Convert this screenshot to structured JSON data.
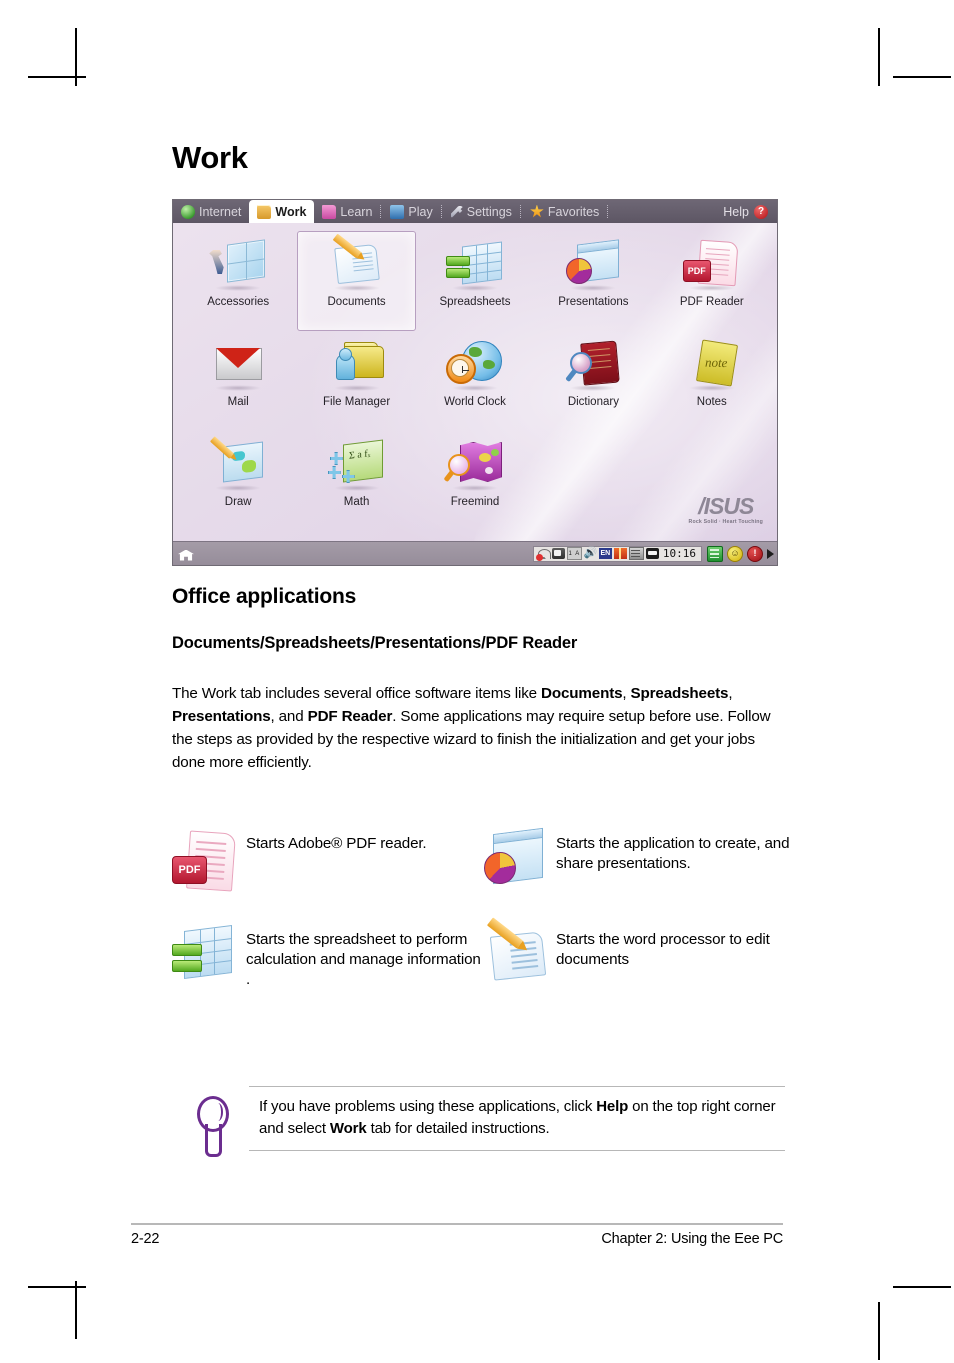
{
  "page": {
    "title": "Work",
    "footer_left": "2-22",
    "footer_right": "Chapter 2: Using the Eee PC"
  },
  "screenshot": {
    "tabs": [
      {
        "label": "Internet",
        "icon": "globe-icon",
        "active": false
      },
      {
        "label": "Work",
        "icon": "folder-work-icon",
        "active": true
      },
      {
        "label": "Learn",
        "icon": "folder-learn-icon",
        "active": false
      },
      {
        "label": "Play",
        "icon": "play-icon",
        "active": false
      },
      {
        "label": "Settings",
        "icon": "wrench-icon",
        "active": false
      },
      {
        "label": "Favorites",
        "icon": "star-icon",
        "active": false
      }
    ],
    "help_label": "Help",
    "help_icon": "question-mark-icon",
    "apps": [
      {
        "label": "Accessories",
        "icon": "accessories-icon",
        "selected": false
      },
      {
        "label": "Documents",
        "icon": "documents-icon",
        "selected": true
      },
      {
        "label": "Spreadsheets",
        "icon": "spreadsheets-icon",
        "selected": false
      },
      {
        "label": "Presentations",
        "icon": "presentations-icon",
        "selected": false
      },
      {
        "label": "PDF Reader",
        "icon": "pdf-reader-icon",
        "selected": false
      },
      {
        "label": "Mail",
        "icon": "mail-icon",
        "selected": false
      },
      {
        "label": "File Manager",
        "icon": "file-manager-icon",
        "selected": false
      },
      {
        "label": "World Clock",
        "icon": "world-clock-icon",
        "selected": false
      },
      {
        "label": "Dictionary",
        "icon": "dictionary-icon",
        "selected": false
      },
      {
        "label": "Notes",
        "icon": "notes-icon",
        "selected": false
      },
      {
        "label": "Draw",
        "icon": "draw-icon",
        "selected": false
      },
      {
        "label": "Math",
        "icon": "math-icon",
        "selected": false
      },
      {
        "label": "Freemind",
        "icon": "freemind-icon",
        "selected": false
      }
    ],
    "pdf_badge_text": "PDF",
    "notes_glyph": "note",
    "math_glyph": "Σ a  fₓ",
    "brand": {
      "word": "/ISUS",
      "tagline": "Rock Solid · Heart Touching"
    },
    "taskbar": {
      "home_icon": "home-icon",
      "tray_icons": [
        "wireless-disabled-icon",
        "battery-icon",
        "keyboard-layout-icon",
        "volume-icon",
        "input-method-en-icon",
        "gift-icon",
        "storage-icon",
        "network-icon"
      ],
      "keyboard_label": "1 A",
      "input_method_label": "EN",
      "clock": "10:16",
      "right_icons": [
        "calculator-icon",
        "smiley-icon",
        "power-icon",
        "expand-arrow-icon"
      ],
      "power_glyph": "!",
      "smiley_glyph": "☺"
    }
  },
  "content": {
    "h2": "Office applications",
    "h3": "Documents/Spreadsheets/Presentations/PDF Reader",
    "paragraph": {
      "p1": "The Work tab includes several office software items like ",
      "b1": "Documents",
      "p2": ", ",
      "b2": "Spreadsheets",
      "p3": ", ",
      "b3": "Presentations",
      "p4": ", and ",
      "b4": "PDF Reader",
      "p5": ". Some applications may require setup before use. Follow the steps as provided by the respective wizard to finish the initialization and get your jobs done more efficiently."
    },
    "descriptions": [
      {
        "icon": "pdf-reader-icon",
        "text": "Starts Adobe® PDF reader."
      },
      {
        "icon": "presentations-icon",
        "text": "Starts the application to create, and share presentations."
      },
      {
        "icon": "spreadsheets-icon",
        "text": "Starts the spreadsheet to perform calculation and manage information ."
      },
      {
        "icon": "documents-icon",
        "text": "Starts the word processor to edit documents"
      }
    ],
    "note": {
      "icon": "tip-bulb-icon",
      "t1": "If you have problems using these applications, click ",
      "b1": "Help",
      "t2": " on the top right corner and select ",
      "b2": "Work",
      "t3": " tab for detailed instructions."
    }
  },
  "colors": {
    "tabbar": "#6e6775",
    "desktop": "#e6dbea",
    "taskbar": "#9b929f",
    "accent_purple": "#6b2d8f",
    "selected_tile_border": "#b79fc0"
  }
}
